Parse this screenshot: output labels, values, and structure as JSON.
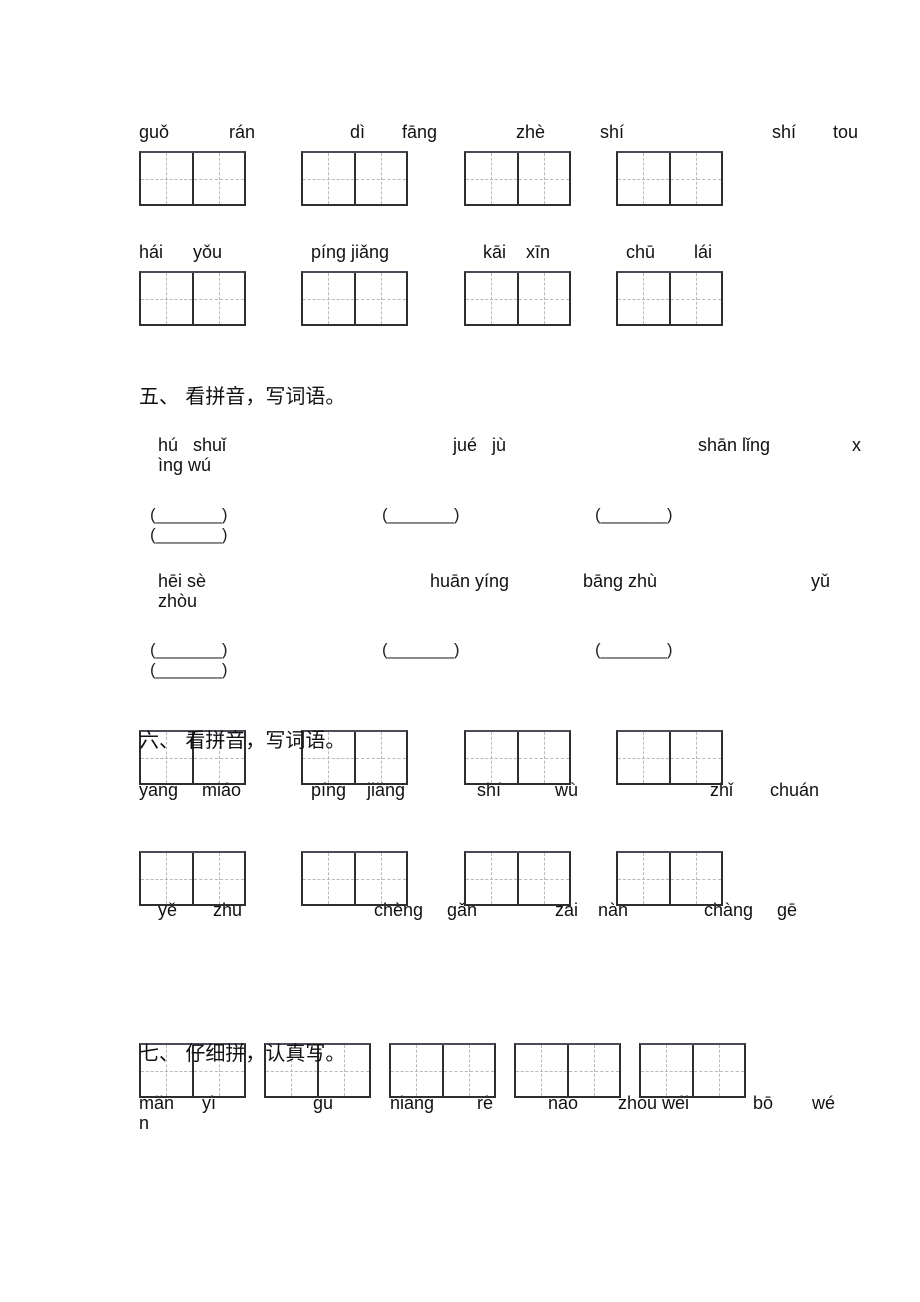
{
  "part_top": {
    "row1_pinyin": [
      "guǒ",
      "rán",
      "dì",
      "fāng",
      "zhè",
      "shí",
      "shí",
      "tou"
    ],
    "row2_pinyin": [
      "hái",
      "yǒu",
      "píng jiǎng",
      "kāi",
      "xīn",
      "chū",
      "lái"
    ]
  },
  "section5": {
    "title": "五、 看拼音，写词语。",
    "group1": {
      "pinyin": [
        "hú   shuǐ",
        "jué   jù",
        "shān lǐng",
        "x"
      ],
      "pinyin_wrap": "ìng wú",
      "blanks": [
        "(_______)",
        "(_______)",
        "(_______)",
        "(_______)"
      ]
    },
    "group2": {
      "pinyin": [
        "hēi sè",
        "huān yíng",
        "bāng zhù",
        "yǔ"
      ],
      "pinyin_wrap": "zhòu",
      "blanks": [
        "(_______)",
        "(_______)",
        "(_______)",
        "(_______)"
      ]
    }
  },
  "section6": {
    "title": "六、 看拼音，写词语。",
    "row1_pinyin": [
      "yāng",
      "miáo",
      "píng",
      "jiǎng",
      "shí",
      "wù",
      "zhǐ",
      "chuán"
    ],
    "row2_pinyin": [
      "yě",
      "zhu",
      "chèng",
      "gǎn",
      "zai",
      "nàn",
      "chàng",
      "gē"
    ]
  },
  "section7": {
    "title": "七、 仔细拼，认真写。",
    "pinyin": [
      "mǎn",
      "yì",
      "gu",
      "niang",
      "rè",
      "nao",
      "zhou wéi",
      "bō",
      "wé"
    ],
    "pinyin_wrap": "n"
  }
}
